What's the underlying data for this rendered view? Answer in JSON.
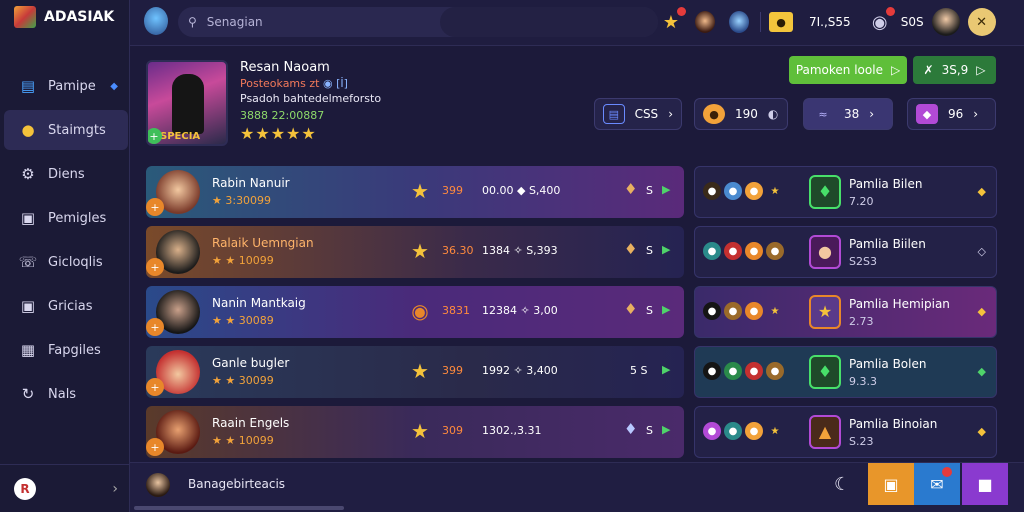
{
  "app": {
    "title": "ADASIAK"
  },
  "sidebar": {
    "items": [
      {
        "label": "Pamipe",
        "icon": "document-icon"
      },
      {
        "label": "Staimgts",
        "icon": "coin-icon"
      },
      {
        "label": "Diens",
        "icon": "gear-icon"
      },
      {
        "label": "Pemigles",
        "icon": "lock-icon"
      },
      {
        "label": "Gicloqlis",
        "icon": "phone-icon"
      },
      {
        "label": "Gricias",
        "icon": "lock-icon"
      },
      {
        "label": "Fapgiles",
        "icon": "grid-icon"
      },
      {
        "label": "Nals",
        "icon": "refresh-icon"
      }
    ]
  },
  "topbar": {
    "search_placeholder": "Senagian",
    "currency": "7I.,S55",
    "gold": "S0S"
  },
  "profile": {
    "name": "Resan Naoam",
    "subtitle_prefix": "Posteokams zt",
    "subtitle_value": "◉ [İ]",
    "description": "Psadoh bahtedelmeforsto",
    "score": "3888 22:00887",
    "stars": "★★★★★",
    "image_label": "SPECIA"
  },
  "actions": {
    "primary": "Pamoken loole",
    "secondary": "3S,9"
  },
  "resources": [
    {
      "icon": "card-icon",
      "value": "CSS"
    },
    {
      "icon": "coin-icon",
      "value": "190"
    },
    {
      "icon": "wing-icon",
      "value": "38"
    },
    {
      "icon": "gem-icon",
      "value": "96"
    }
  ],
  "players": [
    {
      "name": "Rabin Nanuir",
      "score": "★ 3:30099",
      "v1": "399",
      "v2": "00.00 ◆ S,400",
      "gems": "S"
    },
    {
      "name": "Ralaik Uemngian",
      "score": "★ ★ 10099",
      "v1": "36.30",
      "v2": "1384 ✧ S,393",
      "gems": "S"
    },
    {
      "name": "Nanin Mantkaig",
      "score": "★ ★ 30089",
      "v1": "3831",
      "v2": "12384 ✧ 3,00",
      "gems": "S"
    },
    {
      "name": "Ganle bugler",
      "score": "★ ★ 30099",
      "v1": "399",
      "v2": "1992 ✧ 3,400",
      "gems": "5 S"
    },
    {
      "name": "Raain Engels",
      "score": "★ ★ 10099",
      "v1": "309",
      "v2": "1302.,3.31",
      "gems": "S"
    }
  ],
  "rewards": [
    {
      "name": "Pamlia Bilen",
      "value": "7.20"
    },
    {
      "name": "Pamlia Biilen",
      "value": "S2S3"
    },
    {
      "name": "Pamlia Hemipian",
      "value": "2.73"
    },
    {
      "name": "Pamlia Bolen",
      "value": "9.3.3"
    },
    {
      "name": "Pamlia Binoian",
      "value": "S.23"
    }
  ],
  "bottombar": {
    "text": "Banagebirteacis"
  }
}
